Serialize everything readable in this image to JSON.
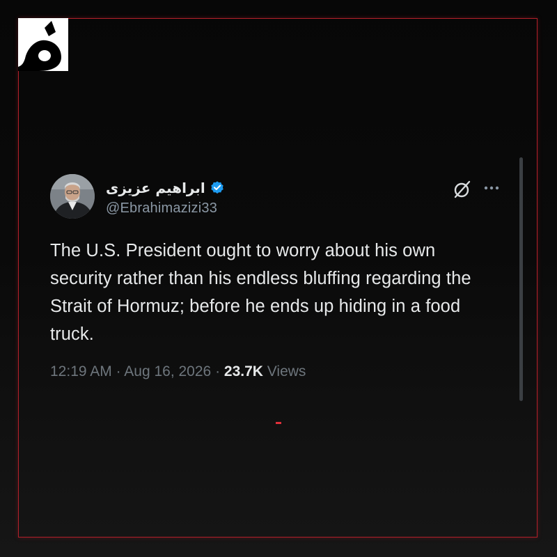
{
  "tweet": {
    "display_name": "ابراهیم عزیزی",
    "handle": "@Ebrahimazizi33",
    "text": "The U.S. President ought to worry about his own security rather than his endless bluffing regarding the Strait of Hormuz; before he ends up hiding in a food truck.",
    "time": "12:19 AM",
    "date": "Aug 16, 2026",
    "views_count": "23.7K",
    "views_label": "Views",
    "separator": "·"
  },
  "icons": {
    "verified": "verified-badge-icon",
    "grok": "grok-icon",
    "more": "more-options-icon",
    "logo": "channel-logo"
  },
  "colors": {
    "background": "#000000",
    "frame_border": "#b3202a",
    "text_primary": "#e7e9ea",
    "text_secondary": "#6e767d",
    "verified_blue": "#1d9bf0",
    "accent_red": "#e0303a"
  }
}
